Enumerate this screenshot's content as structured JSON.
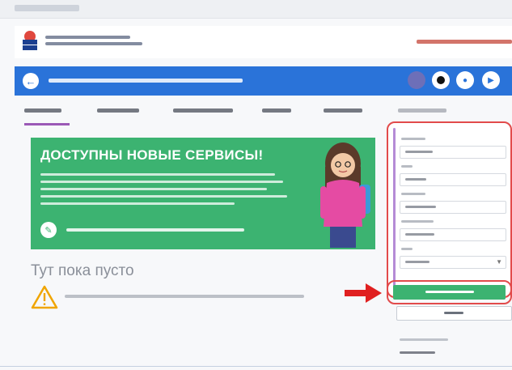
{
  "banner": {
    "title": "ДОСТУПНЫ НОВЫЕ СЕРВИСЫ!"
  },
  "main": {
    "empty_title": "Тут пока пусто"
  },
  "colors": {
    "nav_blue": "#2a73d9",
    "banner_green": "#3cb371",
    "highlight_red": "#e24b4b",
    "tab_accent_purple": "#9b59b6"
  },
  "icons": {
    "back": "arrow-left-icon",
    "banner_action": "document-icon",
    "warning": "warning-triangle-icon",
    "field_select": "chevron-down-icon"
  }
}
